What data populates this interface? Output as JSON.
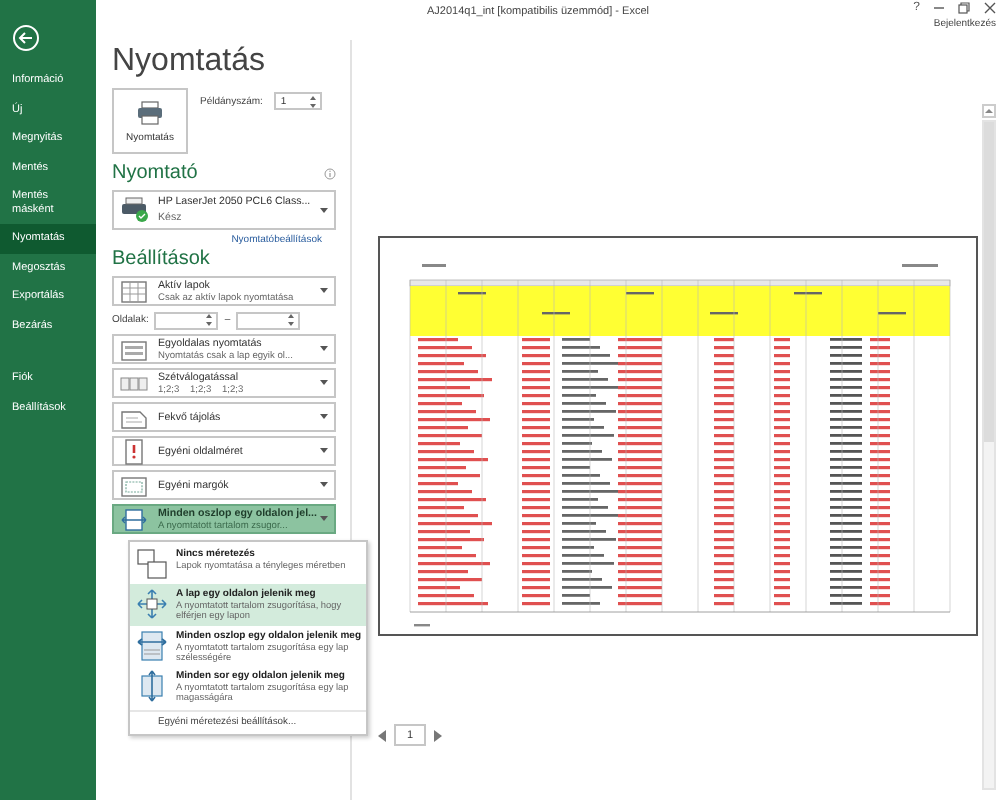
{
  "window": {
    "title": "AJ2014q1_int [kompatibilis üzemmód] - Excel",
    "help": "?",
    "account": "Bejelentkezés"
  },
  "sidebar": {
    "items": [
      {
        "label": "Információ",
        "selected": false
      },
      {
        "label": "Új",
        "selected": false
      },
      {
        "label": "Megnyitás",
        "selected": false
      },
      {
        "label": "Mentés",
        "selected": false
      },
      {
        "label": "Mentés másként",
        "selected": false
      },
      {
        "label": "Nyomtatás",
        "selected": true
      },
      {
        "label": "Megosztás",
        "selected": false
      },
      {
        "label": "Exportálás",
        "selected": false
      },
      {
        "label": "Bezárás",
        "selected": false
      }
    ],
    "bottom_items": [
      {
        "label": "Fiók",
        "selected": false
      },
      {
        "label": "Beállítások",
        "selected": false
      }
    ]
  },
  "print": {
    "heading": "Nyomtatás",
    "button": "Nyomtatás",
    "copies_label": "Példányszám:",
    "copies_value": "1"
  },
  "printer": {
    "heading": "Nyomtató",
    "name": "HP LaserJet 2050 PCL6 Class...",
    "status": "Kész",
    "properties_link": "Nyomtatóbeállítások"
  },
  "settings": {
    "heading": "Beállítások",
    "items": [
      {
        "kind": "dropdown",
        "title": "Aktív lapok",
        "subtitle": "Csak az aktív lapok nyomtatása",
        "expanded": false
      },
      {
        "kind": "range",
        "label": "Oldalak:",
        "separator": "–"
      },
      {
        "kind": "dropdown",
        "title": "Egyoldalas nyomtatás",
        "subtitle": "Nyomtatás csak a lap egyik ol...",
        "expanded": false
      },
      {
        "kind": "dropdown",
        "title": "Szétválogatással",
        "subtitle": "1;2;3    1;2;3    1;2;3",
        "expanded": false
      },
      {
        "kind": "dropdown",
        "title": "Fekvő tájolás",
        "expanded": false
      },
      {
        "kind": "dropdown",
        "title": "Egyéni oldalméret",
        "expanded": false
      },
      {
        "kind": "dropdown",
        "title": "Egyéni margók",
        "expanded": false
      },
      {
        "kind": "dropdown",
        "title": "Minden oszlop egy oldalon jel...",
        "subtitle": "A nyomtatott tartalom zsugor...",
        "expanded": true
      }
    ]
  },
  "scaling_menu": {
    "items": [
      {
        "title": "Nincs méretezés",
        "description": "Lapok nyomtatása a tényleges méretben",
        "highlighted": false
      },
      {
        "title": "A lap egy oldalon jelenik meg",
        "description": "A nyomtatott tartalom zsugorítása, hogy elférjen egy lapon",
        "highlighted": true
      },
      {
        "title": "Minden oszlop egy oldalon jelenik meg",
        "description": "A nyomtatott tartalom zsugorítása egy lap szélességére",
        "highlighted": false
      },
      {
        "title": "Minden sor egy oldalon jelenik meg",
        "description": "A nyomtatott tartalom zsugorítása egy lap magasságára",
        "highlighted": false
      }
    ],
    "footer": "Egyéni méretezési beállítások..."
  },
  "page_nav": {
    "page": "1"
  }
}
